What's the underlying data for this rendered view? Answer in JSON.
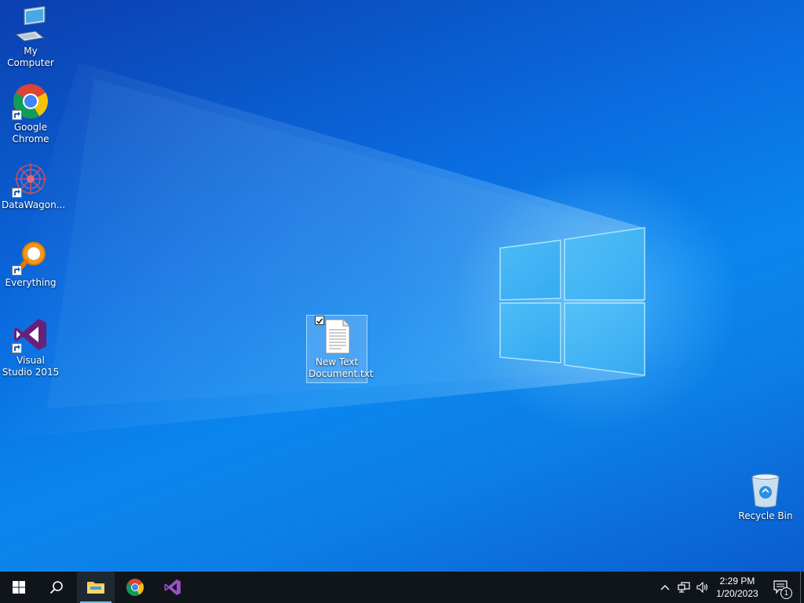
{
  "desktop": {
    "icons": [
      {
        "label": "My Computer",
        "icon": "computer-icon",
        "shortcut": false
      },
      {
        "label": "Google Chrome",
        "icon": "chrome-icon",
        "shortcut": true
      },
      {
        "label": "DataWagon...",
        "icon": "datawagon-icon",
        "shortcut": true
      },
      {
        "label": "Everything",
        "icon": "everything-icon",
        "shortcut": true
      },
      {
        "label": "Visual Studio 2015",
        "icon": "visual-studio-icon",
        "shortcut": true
      },
      {
        "label": "New Text Document.txt",
        "icon": "text-document-icon",
        "selected": true
      },
      {
        "label": "Recycle Bin",
        "icon": "recycle-bin-icon",
        "shortcut": false
      }
    ]
  },
  "taskbar": {
    "pinned": [
      {
        "name": "File Explorer",
        "icon": "folder-icon",
        "active": true
      },
      {
        "name": "Google Chrome",
        "icon": "chrome-icon",
        "active": false
      },
      {
        "name": "Visual Studio",
        "icon": "visual-studio-icon",
        "active": false
      }
    ],
    "clock": {
      "time": "2:29 PM",
      "date": "1/20/2023"
    },
    "notifications": {
      "count": "1"
    }
  },
  "colors": {
    "desktop_blue": "#0a6ce0",
    "taskbar": "#10151c",
    "active_indicator": "#76b9ed"
  }
}
